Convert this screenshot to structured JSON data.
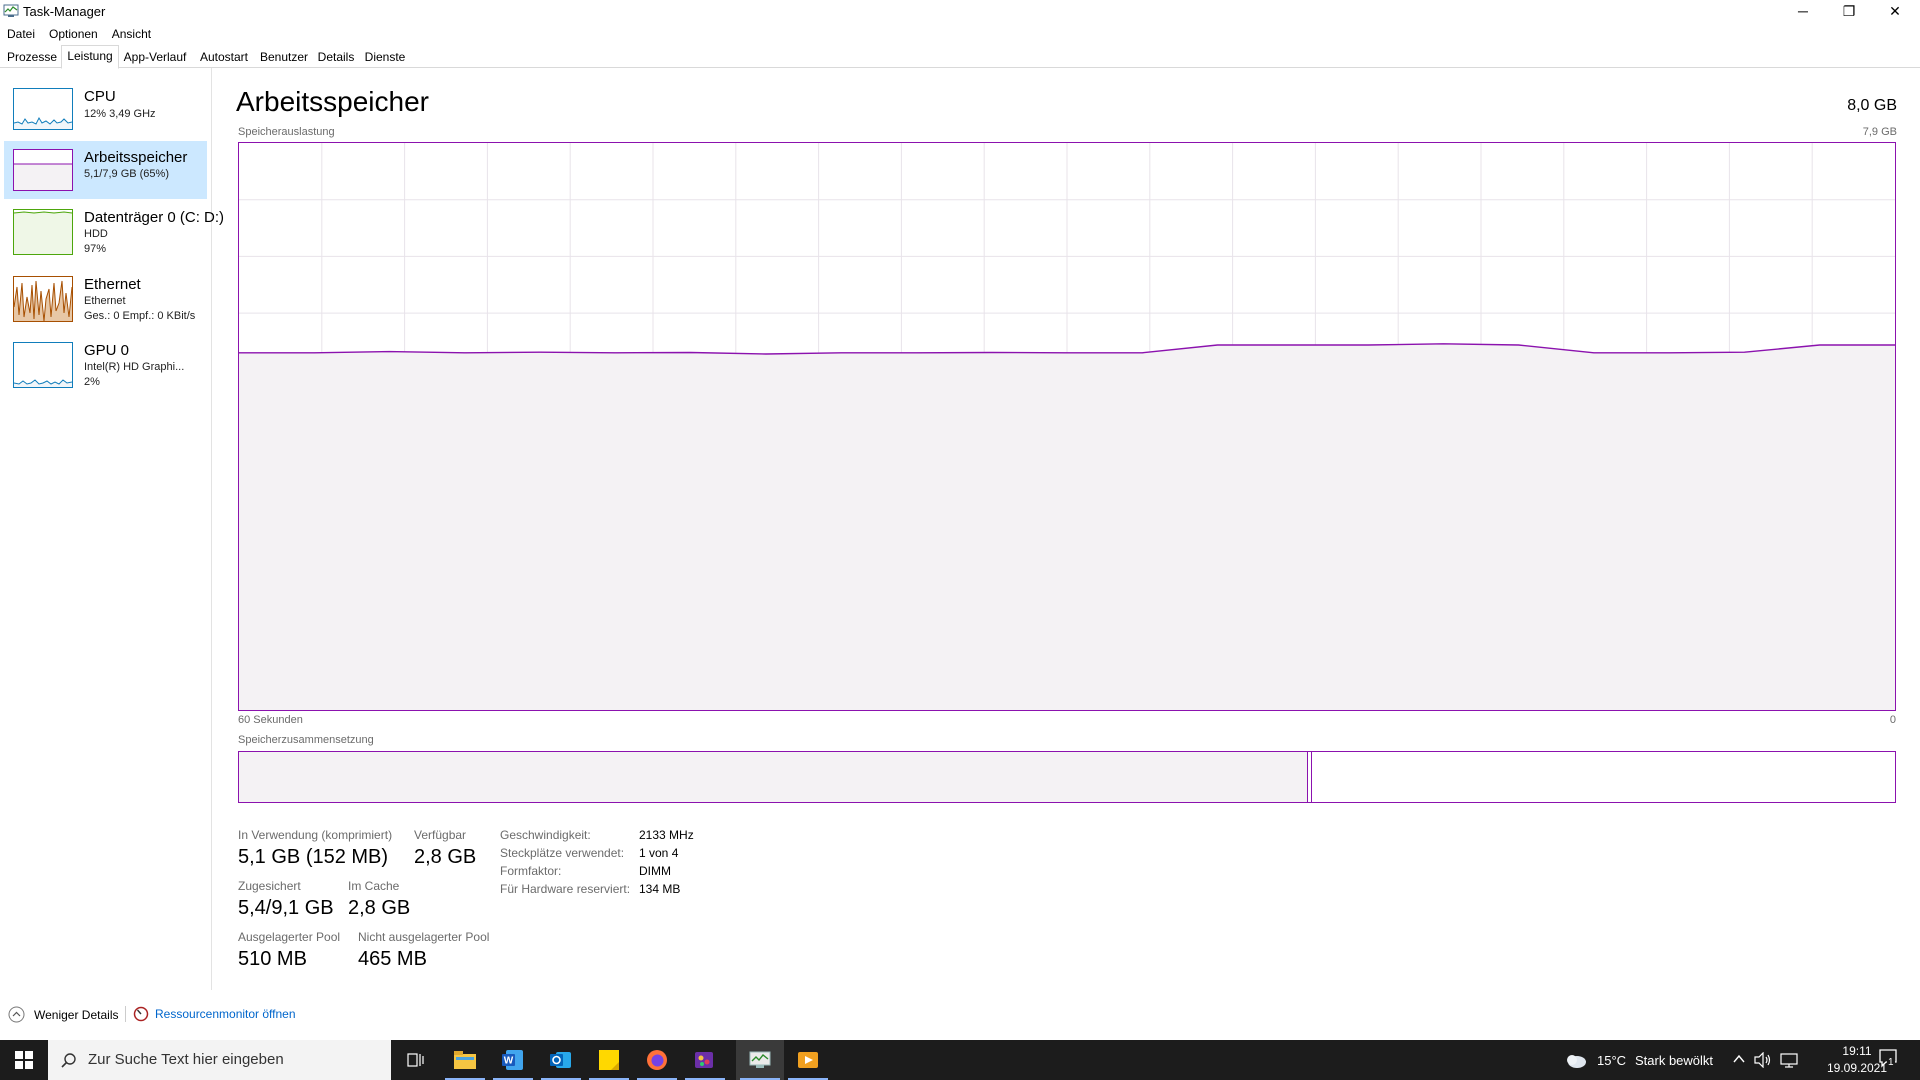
{
  "window": {
    "title": "Task-Manager",
    "minimize_glyph": "─",
    "maximize_glyph": "❐",
    "close_glyph": "✕"
  },
  "menu": [
    "Datei",
    "Optionen",
    "Ansicht"
  ],
  "tabs": [
    "Prozesse",
    "Leistung",
    "App-Verlauf",
    "Autostart",
    "Benutzer",
    "Details",
    "Dienste"
  ],
  "sidebar": {
    "items": [
      {
        "name": "CPU",
        "sub": "12% 3,49 GHz",
        "sub2": "",
        "sub3": "",
        "color": "#117dbb",
        "fill": "#f1f6fa"
      },
      {
        "name": "Arbeitsspeicher",
        "sub": "5,1/7,9 GB (65%)",
        "sub2": "",
        "sub3": "",
        "color": "#8b12ae",
        "fill": "#f4f2f4"
      },
      {
        "name": "Datenträger 0 (C: D:)",
        "sub": "HDD",
        "sub2": "97%",
        "sub3": "",
        "color": "#4da60c",
        "fill": "#eff7e7"
      },
      {
        "name": "Ethernet",
        "sub": "Ethernet",
        "sub2": "Ges.: 0 Empf.: 0 KBit/s",
        "sub3": "",
        "color": "#a74f01",
        "fill": "#fcf3eb"
      },
      {
        "name": "GPU 0",
        "sub": "Intel(R) HD Graphi...",
        "sub2": "2%",
        "sub3": "",
        "color": "#117dbb",
        "fill": "#f1f6fa"
      }
    ]
  },
  "main": {
    "title": "Arbeitsspeicher",
    "capacity": "8,0 GB",
    "usage_label": "Speicherauslastung",
    "usage_max": "7,9 GB",
    "time_label": "60 Sekunden",
    "time_zero": "0",
    "composition_label": "Speicherzusammensetzung",
    "composition_in_use_fraction": 0.645,
    "usage_percent": 63,
    "stats": {
      "in_use_label": "In Verwendung (komprimiert)",
      "in_use_value": "5,1 GB (152 MB)",
      "available_label": "Verfügbar",
      "available_value": "2,8 GB",
      "committed_label": "Zugesichert",
      "committed_value": "5,4/9,1 GB",
      "cached_label": "Im Cache",
      "cached_value": "2,8 GB",
      "paged_label": "Ausgelagerter Pool",
      "paged_value": "510 MB",
      "nonpaged_label": "Nicht ausgelagerter Pool",
      "nonpaged_value": "465 MB"
    },
    "details": [
      {
        "label": "Geschwindigkeit:",
        "value": "2133 MHz"
      },
      {
        "label": "Steckplätze verwendet:",
        "value": "1 von 4"
      },
      {
        "label": "Formfaktor:",
        "value": "DIMM"
      },
      {
        "label": "Für Hardware reserviert:",
        "value": "134 MB"
      }
    ]
  },
  "footer": {
    "fewer_details": "Weniger Details",
    "resource_monitor": "Ressourcenmonitor öffnen"
  },
  "taskbar": {
    "search_placeholder": "Zur Suche Text hier eingeben",
    "weather_temp": "15°C",
    "weather_text": "Stark bewölkt",
    "time": "19:11",
    "date": "19.09.2021",
    "notification_count": "1"
  },
  "colors": {
    "memory": "#8b12ae",
    "memory_fill": "#f4f2f4",
    "selected": "#cce8ff",
    "link": "#0066cc"
  }
}
